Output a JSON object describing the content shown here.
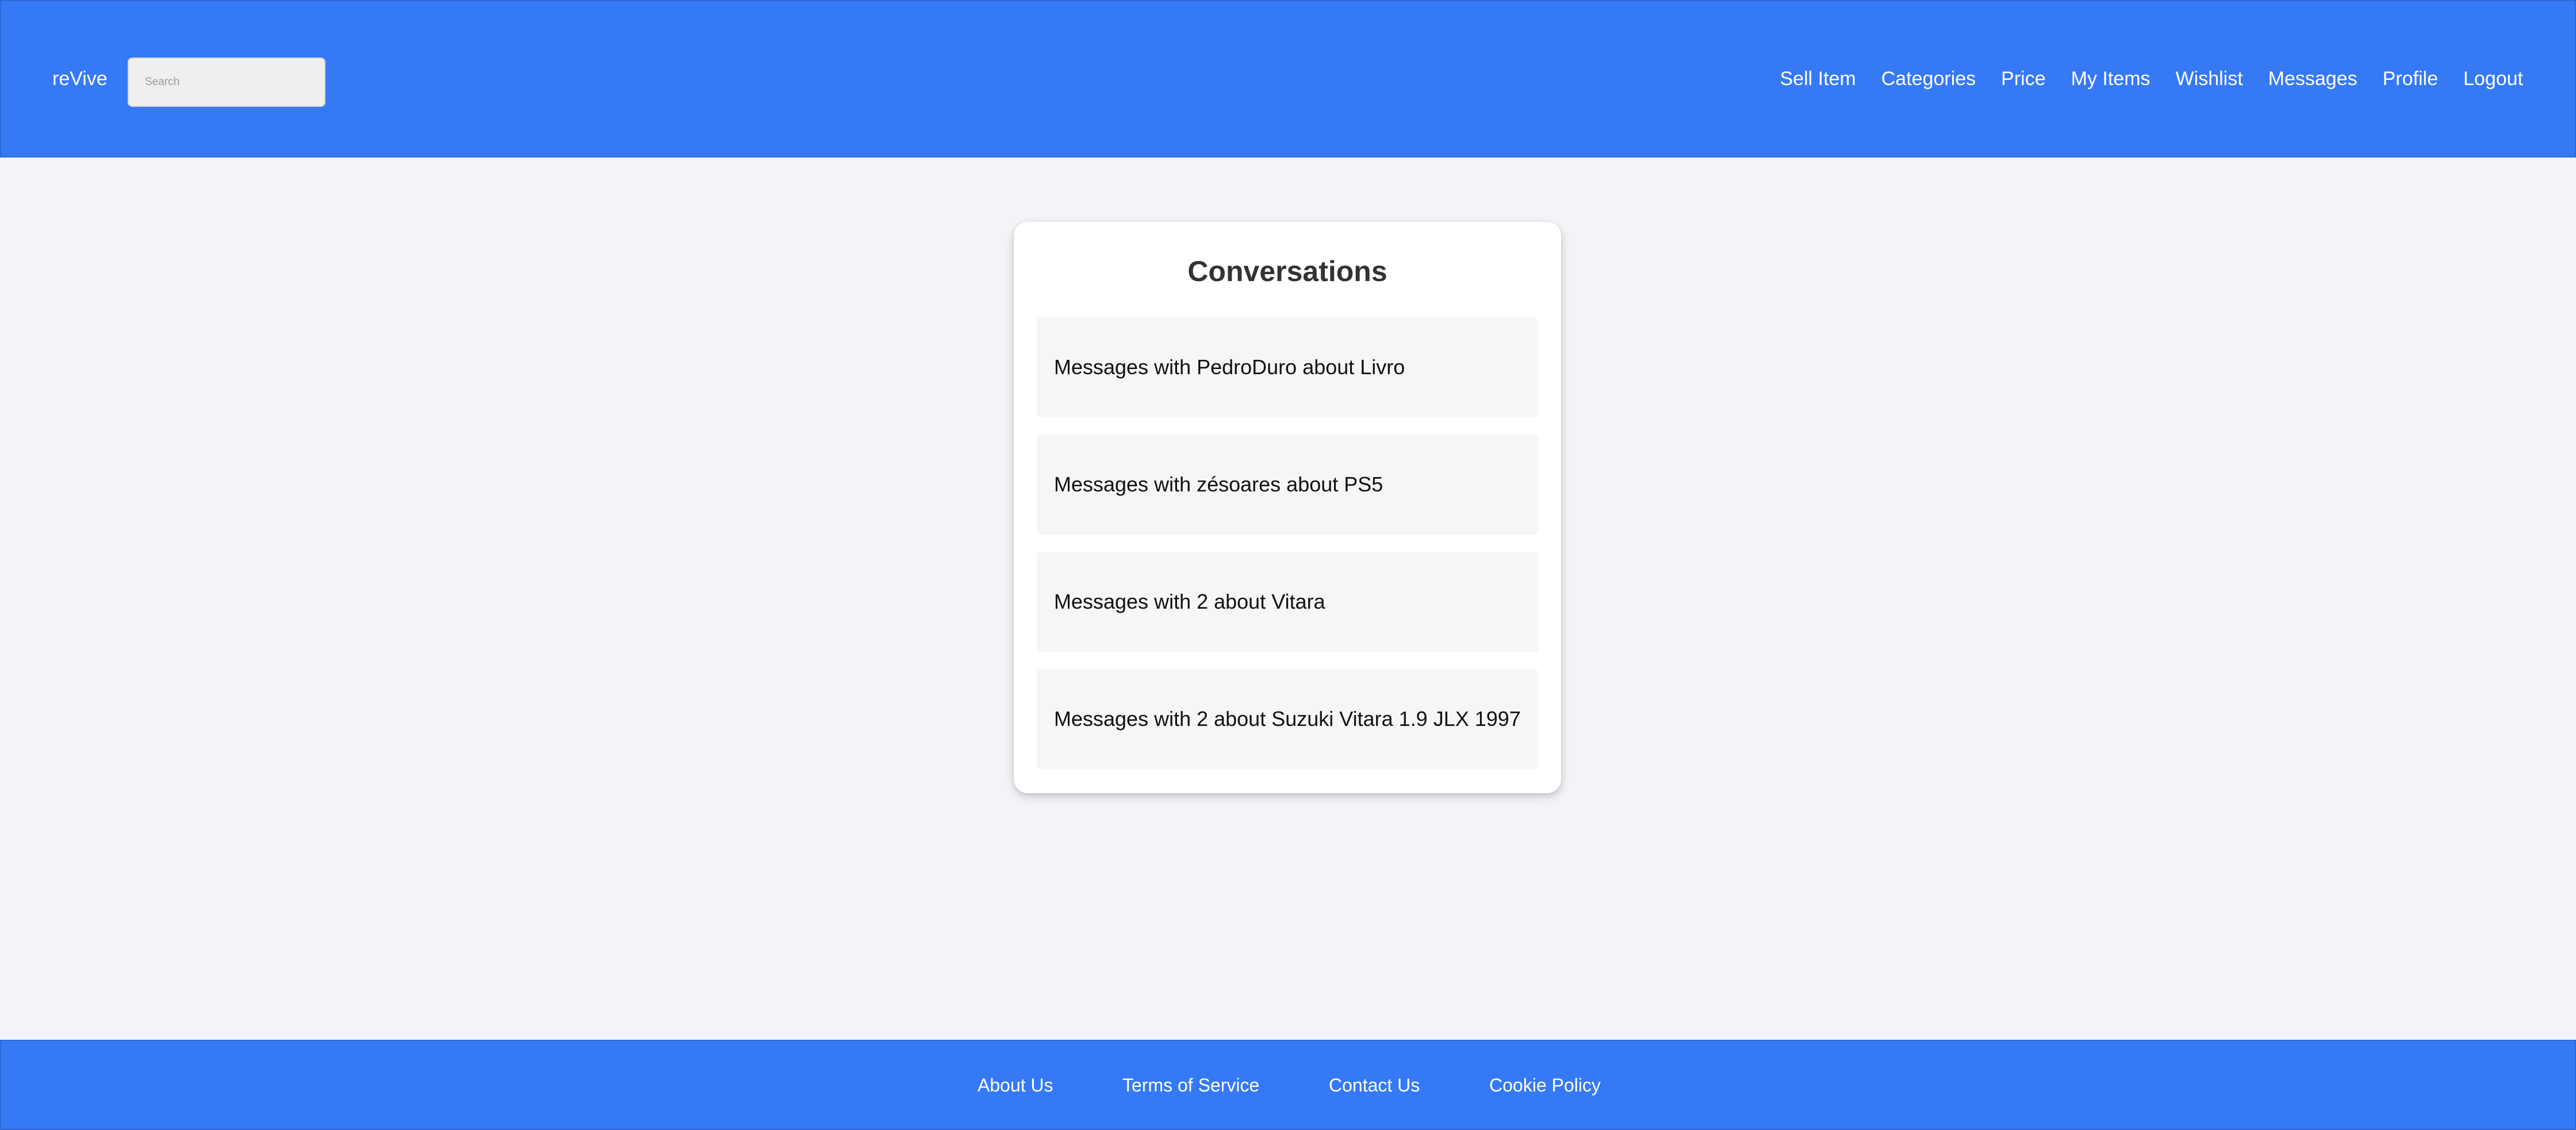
{
  "header": {
    "brand": "reVive",
    "search_placeholder": "Search",
    "nav": [
      {
        "label": "Sell Item"
      },
      {
        "label": "Categories"
      },
      {
        "label": "Price"
      },
      {
        "label": "My Items"
      },
      {
        "label": "Wishlist"
      },
      {
        "label": "Messages"
      },
      {
        "label": "Profile"
      },
      {
        "label": "Logout"
      }
    ],
    "color": "#3679f5"
  },
  "main": {
    "title": "Conversations",
    "conversations": [
      {
        "label": "Messages with PedroDuro about Livro"
      },
      {
        "label": "Messages with zésoares about PS5"
      },
      {
        "label": "Messages with 2 about Vitara"
      },
      {
        "label": "Messages with 2 about Suzuki Vitara 1.9 JLX 1997"
      }
    ]
  },
  "footer": {
    "links": [
      {
        "label": "About Us"
      },
      {
        "label": "Terms of Service"
      },
      {
        "label": "Contact Us"
      },
      {
        "label": "Cookie Policy"
      }
    ]
  }
}
